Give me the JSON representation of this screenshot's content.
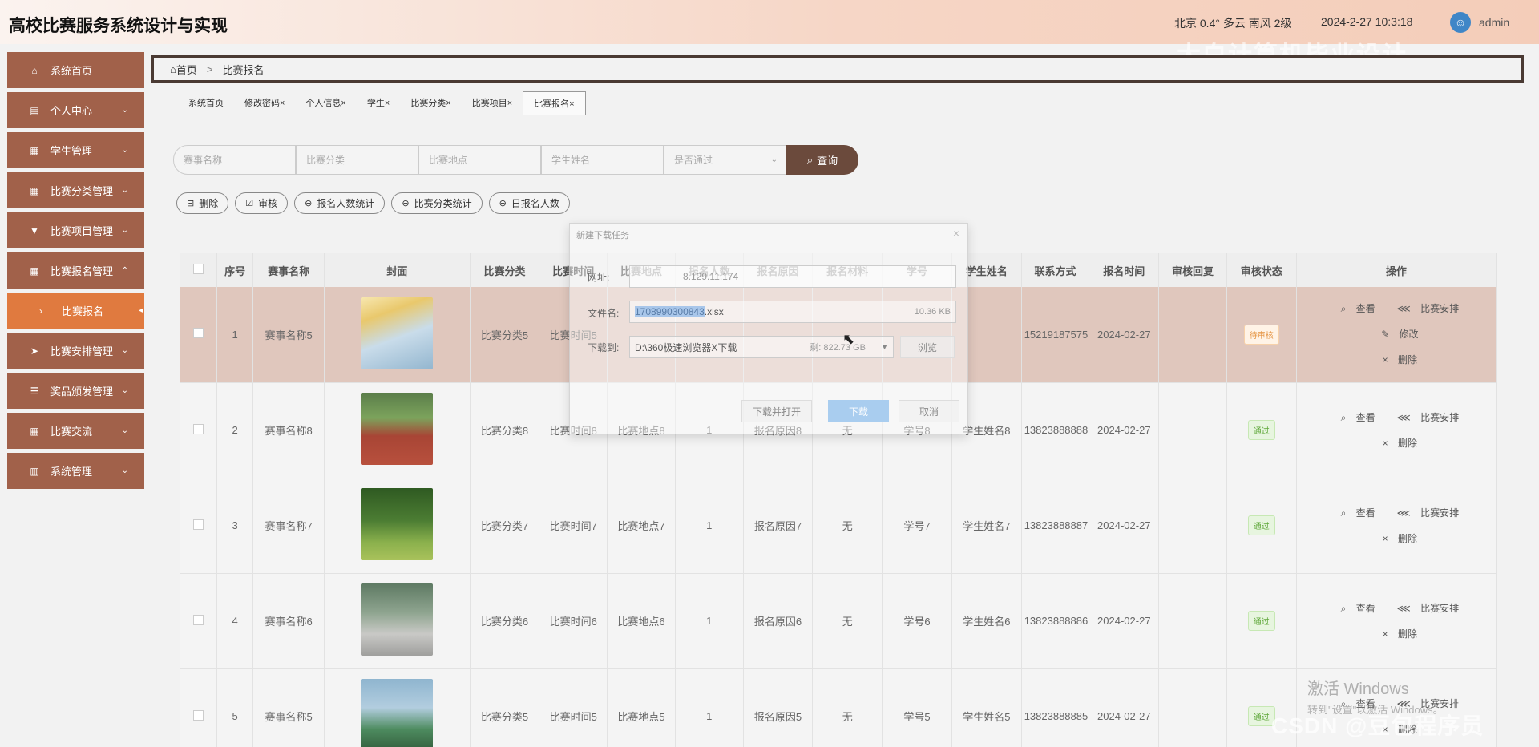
{
  "app": {
    "title": "高校比赛服务系统设计与实现",
    "weather": "北京  0.4°  多云  南风  2级",
    "datetime": "2024-2-27 10:3:18",
    "user": "admin",
    "watermark": "大白计算机毕业设计"
  },
  "sidebar": {
    "items": [
      {
        "label": "系统首页",
        "icon": "home-icon",
        "glyph": "⌂",
        "chev": ""
      },
      {
        "label": "个人中心",
        "icon": "calendar-icon",
        "glyph": "▤",
        "chev": "⌄"
      },
      {
        "label": "学生管理",
        "icon": "grid-icon",
        "glyph": "▦",
        "chev": "⌄"
      },
      {
        "label": "比赛分类管理",
        "icon": "grid-icon",
        "glyph": "▦",
        "chev": "⌄"
      },
      {
        "label": "比赛项目管理",
        "icon": "brush-icon",
        "glyph": "▼",
        "chev": "⌄"
      },
      {
        "label": "比赛报名管理",
        "icon": "grid-icon",
        "glyph": "▦",
        "chev": "⌃"
      },
      {
        "label": "比赛报名",
        "icon": "caret-right-icon",
        "glyph": "›",
        "chev": "◂"
      },
      {
        "label": "比赛安排管理",
        "icon": "send-icon",
        "glyph": "➤",
        "chev": "⌄"
      },
      {
        "label": "奖品颁发管理",
        "icon": "sliders-icon",
        "glyph": "☰",
        "chev": "⌄"
      },
      {
        "label": "比赛交流",
        "icon": "grid-icon",
        "glyph": "▦",
        "chev": "⌄"
      },
      {
        "label": "系统管理",
        "icon": "chart-icon",
        "glyph": "▥",
        "chev": "⌄"
      }
    ]
  },
  "breadcrumb": {
    "home": "首页",
    "sep": ">",
    "current": "比赛报名"
  },
  "tabs": [
    {
      "label": "系统首页"
    },
    {
      "label": "修改密码×"
    },
    {
      "label": "个人信息×"
    },
    {
      "label": "学生×"
    },
    {
      "label": "比赛分类×"
    },
    {
      "label": "比赛项目×"
    },
    {
      "label": "比赛报名×"
    }
  ],
  "search": {
    "name_placeholder": "赛事名称",
    "category_placeholder": "比赛分类",
    "location_placeholder": "比赛地点",
    "student_placeholder": "学生姓名",
    "passed_placeholder": "是否通过",
    "query_label": "查询"
  },
  "actions": {
    "delete": "删除",
    "audit": "审核",
    "count_stat": "报名人数统计",
    "category_stat": "比赛分类统计",
    "daily_count": "日报名人数"
  },
  "table": {
    "headers": [
      "",
      "序号",
      "赛事名称",
      "封面",
      "比赛分类",
      "比赛时间",
      "比赛地点",
      "报名人数",
      "报名原因",
      "报名材料",
      "学号",
      "学生姓名",
      "联系方式",
      "报名时间",
      "审核回复",
      "审核状态",
      "操作"
    ],
    "rows": [
      {
        "no": "1",
        "name": "赛事名称5",
        "cover": "skiing",
        "category": "比赛分类5",
        "time": "比赛时间5",
        "location": "",
        "count": "",
        "reason": "",
        "material": "",
        "sid": "",
        "student": "",
        "phone": "15219187575",
        "regtime": "2024-02-27",
        "reply": "",
        "status": "待审核",
        "ops": [
          "查看",
          "比赛安排",
          "修改",
          "删除"
        ]
      },
      {
        "no": "2",
        "name": "赛事名称8",
        "cover": "track",
        "category": "比赛分类8",
        "time": "比赛时间8",
        "location": "比赛地点8",
        "count": "1",
        "reason": "报名原因8",
        "material": "无",
        "sid": "学号8",
        "student": "学生姓名8",
        "phone": "13823888888",
        "regtime": "2024-02-27",
        "reply": "",
        "status": "通过",
        "ops": [
          "查看",
          "比赛安排",
          "删除"
        ]
      },
      {
        "no": "3",
        "name": "赛事名称7",
        "cover": "running",
        "category": "比赛分类7",
        "time": "比赛时间7",
        "location": "比赛地点7",
        "count": "1",
        "reason": "报名原因7",
        "material": "无",
        "sid": "学号7",
        "student": "学生姓名7",
        "phone": "13823888887",
        "regtime": "2024-02-27",
        "reply": "",
        "status": "通过",
        "ops": [
          "查看",
          "比赛安排",
          "删除"
        ]
      },
      {
        "no": "4",
        "name": "赛事名称6",
        "cover": "cycling",
        "category": "比赛分类6",
        "time": "比赛时间6",
        "location": "比赛地点6",
        "count": "1",
        "reason": "报名原因6",
        "material": "无",
        "sid": "学号6",
        "student": "学生姓名6",
        "phone": "13823888886",
        "regtime": "2024-02-27",
        "reply": "",
        "status": "通过",
        "ops": [
          "查看",
          "比赛安排",
          "删除"
        ]
      },
      {
        "no": "5",
        "name": "赛事名称5",
        "cover": "cycling2",
        "category": "比赛分类5",
        "time": "比赛时间5",
        "location": "比赛地点5",
        "count": "1",
        "reason": "报名原因5",
        "material": "无",
        "sid": "学号5",
        "student": "学生姓名5",
        "phone": "13823888885",
        "regtime": "2024-02-27",
        "reply": "",
        "status": "通过",
        "ops": [
          "查看",
          "比赛安排",
          "删除"
        ]
      }
    ]
  },
  "dialog": {
    "title": "新建下载任务",
    "url_label": "网址:",
    "url_value": "8.129.11.174",
    "filename_label": "文件名:",
    "filename_selected": "1708990300843",
    "filename_ext": ".xlsx",
    "filesize": "10.36 KB",
    "saveto_label": "下载到:",
    "saveto_value": "D:\\360极速浏览器X下载",
    "free_space": "剩: 822.73 GB",
    "browse": "浏览",
    "download_open": "下载并打开",
    "download": "下载",
    "cancel": "取消"
  },
  "watermarks": {
    "windows_line1": "激活 Windows",
    "windows_line2": "转到\"设置\"以激活 Windows。",
    "csdn": "CSDN @豆包程序员"
  },
  "colors": {
    "sidebar": "#a1614a",
    "sidebar_active": "#e07a3f",
    "query_button": "#6b4a3c",
    "highlight_row": "#e0c7bd"
  }
}
